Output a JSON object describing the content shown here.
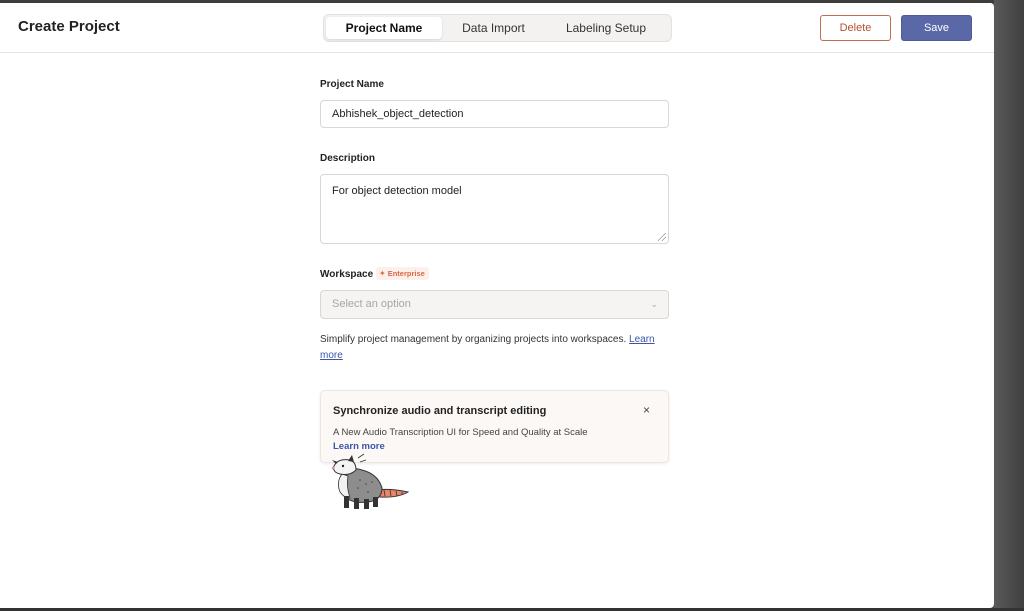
{
  "header": {
    "title": "Create Project",
    "tabs": [
      {
        "label": "Project Name",
        "active": true
      },
      {
        "label": "Data Import",
        "active": false
      },
      {
        "label": "Labeling Setup",
        "active": false
      }
    ],
    "delete_label": "Delete",
    "save_label": "Save"
  },
  "form": {
    "project_name": {
      "label": "Project Name",
      "value": "Abhishek_object_detection"
    },
    "description": {
      "label": "Description",
      "value": "For object detection model"
    },
    "workspace": {
      "label": "Workspace",
      "badge": "Enterprise",
      "placeholder": "Select an option",
      "help_text": "Simplify project management by organizing projects into workspaces.",
      "help_link_1": "Learn",
      "help_link_2": "more"
    }
  },
  "promo": {
    "title": "Synchronize audio and transcript editing",
    "text": "A New Audio Transcription UI for Speed and Quality at Scale",
    "link": "Learn more",
    "close": "×"
  },
  "icons": {
    "close": "close-icon",
    "chevron": "chevron-down-icon",
    "sparkle": "sparkle-icon",
    "mascot": "opossum-mascot"
  },
  "colors": {
    "save_bg": "#5a68a8",
    "delete_border": "#c46c52",
    "link": "#3c56a8",
    "enterprise": "#d9694a"
  }
}
